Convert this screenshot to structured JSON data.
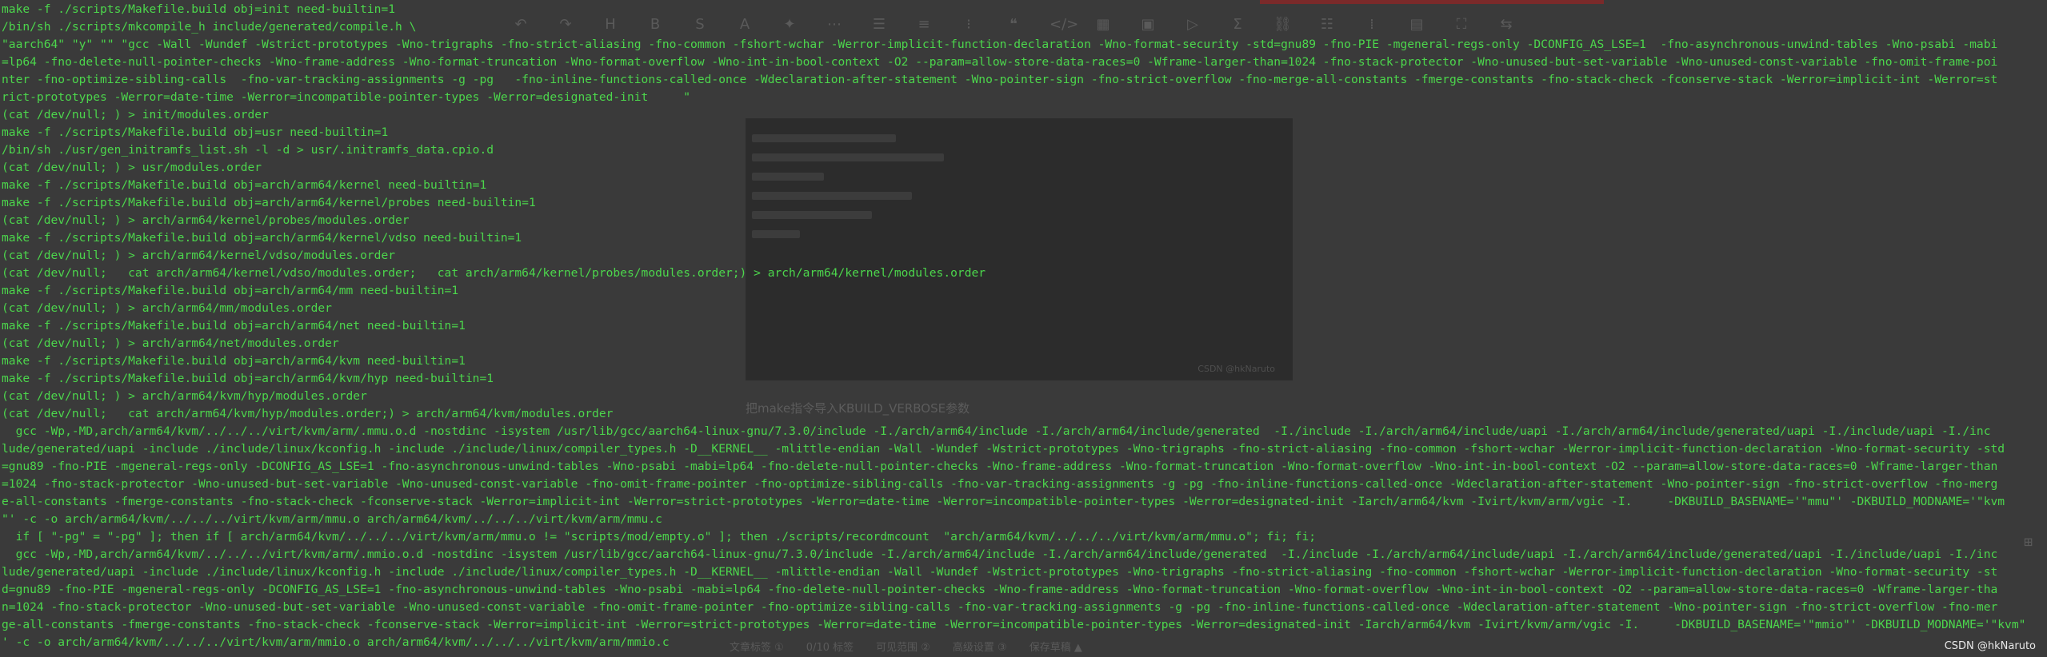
{
  "editor": {
    "toolbar_icons": [
      "undo-icon",
      "redo-icon",
      "heading-icon",
      "bold-icon",
      "strikethrough-icon",
      "color-icon",
      "format-clear-icon",
      "more-icon",
      "list-unordered-icon",
      "align-icon",
      "list-ordered-icon",
      "quote-icon",
      "code-icon",
      "table-icon",
      "image-icon",
      "video-icon",
      "formula-icon",
      "link-icon",
      "toc-icon",
      "outline-icon",
      "template-icon",
      "fullscreen-icon",
      "swap-icon"
    ],
    "caption": "把make指令导入KBUILD_VERBOSE参数",
    "code_watermark": "CSDN @hkNaruto",
    "bottom_items": [
      "文章标签 ①",
      "0/10 标签",
      "可见范围 ②",
      "高级设置 ③",
      "保存草稿 ▲"
    ]
  },
  "terminal": {
    "lines": [
      "make -f ./scripts/Makefile.build obj=init need-builtin=1",
      "/bin/sh ./scripts/mkcompile_h include/generated/compile.h \\",
      "\"aarch64\" \"y\" \"\" \"gcc -Wall -Wundef -Wstrict-prototypes -Wno-trigraphs -fno-strict-aliasing -fno-common -fshort-wchar -Werror-implicit-function-declaration -Wno-format-security -std=gnu89 -fno-PIE -mgeneral-regs-only -DCONFIG_AS_LSE=1  -fno-asynchronous-unwind-tables -Wno-psabi -mabi",
      "=lp64 -fno-delete-null-pointer-checks -Wno-frame-address -Wno-format-truncation -Wno-format-overflow -Wno-int-in-bool-context -O2 --param=allow-store-data-races=0 -Wframe-larger-than=1024 -fno-stack-protector -Wno-unused-but-set-variable -Wno-unused-const-variable -fno-omit-frame-poi",
      "nter -fno-optimize-sibling-calls  -fno-var-tracking-assignments -g -pg   -fno-inline-functions-called-once -Wdeclaration-after-statement -Wno-pointer-sign -fno-strict-overflow -fno-merge-all-constants -fmerge-constants -fno-stack-check -fconserve-stack -Werror=implicit-int -Werror=st",
      "rict-prototypes -Werror=date-time -Werror=incompatible-pointer-types -Werror=designated-init     \"",
      "(cat /dev/null; ) > init/modules.order",
      "make -f ./scripts/Makefile.build obj=usr need-builtin=1",
      "/bin/sh ./usr/gen_initramfs_list.sh -l -d > usr/.initramfs_data.cpio.d",
      "(cat /dev/null; ) > usr/modules.order",
      "make -f ./scripts/Makefile.build obj=arch/arm64/kernel need-builtin=1",
      "make -f ./scripts/Makefile.build obj=arch/arm64/kernel/probes need-builtin=1",
      "(cat /dev/null; ) > arch/arm64/kernel/probes/modules.order",
      "make -f ./scripts/Makefile.build obj=arch/arm64/kernel/vdso need-builtin=1",
      "(cat /dev/null; ) > arch/arm64/kernel/vdso/modules.order",
      "(cat /dev/null;   cat arch/arm64/kernel/vdso/modules.order;   cat arch/arm64/kernel/probes/modules.order;) > arch/arm64/kernel/modules.order",
      "make -f ./scripts/Makefile.build obj=arch/arm64/mm need-builtin=1",
      "(cat /dev/null; ) > arch/arm64/mm/modules.order",
      "make -f ./scripts/Makefile.build obj=arch/arm64/net need-builtin=1",
      "(cat /dev/null; ) > arch/arm64/net/modules.order",
      "make -f ./scripts/Makefile.build obj=arch/arm64/kvm need-builtin=1",
      "make -f ./scripts/Makefile.build obj=arch/arm64/kvm/hyp need-builtin=1",
      "(cat /dev/null; ) > arch/arm64/kvm/hyp/modules.order",
      "(cat /dev/null;   cat arch/arm64/kvm/hyp/modules.order;) > arch/arm64/kvm/modules.order",
      "  gcc -Wp,-MD,arch/arm64/kvm/../../../virt/kvm/arm/.mmu.o.d -nostdinc -isystem /usr/lib/gcc/aarch64-linux-gnu/7.3.0/include -I./arch/arm64/include -I./arch/arm64/include/generated  -I./include -I./arch/arm64/include/uapi -I./arch/arm64/include/generated/uapi -I./include/uapi -I./inc",
      "lude/generated/uapi -include ./include/linux/kconfig.h -include ./include/linux/compiler_types.h -D__KERNEL__ -mlittle-endian -Wall -Wundef -Wstrict-prototypes -Wno-trigraphs -fno-strict-aliasing -fno-common -fshort-wchar -Werror-implicit-function-declaration -Wno-format-security -std",
      "=gnu89 -fno-PIE -mgeneral-regs-only -DCONFIG_AS_LSE=1 -fno-asynchronous-unwind-tables -Wno-psabi -mabi=lp64 -fno-delete-null-pointer-checks -Wno-frame-address -Wno-format-truncation -Wno-format-overflow -Wno-int-in-bool-context -O2 --param=allow-store-data-races=0 -Wframe-larger-than",
      "=1024 -fno-stack-protector -Wno-unused-but-set-variable -Wno-unused-const-variable -fno-omit-frame-pointer -fno-optimize-sibling-calls -fno-var-tracking-assignments -g -pg -fno-inline-functions-called-once -Wdeclaration-after-statement -Wno-pointer-sign -fno-strict-overflow -fno-merg",
      "e-all-constants -fmerge-constants -fno-stack-check -fconserve-stack -Werror=implicit-int -Werror=strict-prototypes -Werror=date-time -Werror=incompatible-pointer-types -Werror=designated-init -Iarch/arm64/kvm -Ivirt/kvm/arm/vgic -I.     -DKBUILD_BASENAME='\"mmu\"' -DKBUILD_MODNAME='\"kvm",
      "\"' -c -o arch/arm64/kvm/../../../virt/kvm/arm/mmu.o arch/arm64/kvm/../../../virt/kvm/arm/mmu.c",
      "  if [ \"-pg\" = \"-pg\" ]; then if [ arch/arm64/kvm/../../../virt/kvm/arm/mmu.o != \"scripts/mod/empty.o\" ]; then ./scripts/recordmcount  \"arch/arm64/kvm/../../../virt/kvm/arm/mmu.o\"; fi; fi;",
      "  gcc -Wp,-MD,arch/arm64/kvm/../../../virt/kvm/arm/.mmio.o.d -nostdinc -isystem /usr/lib/gcc/aarch64-linux-gnu/7.3.0/include -I./arch/arm64/include -I./arch/arm64/include/generated  -I./include -I./arch/arm64/include/uapi -I./arch/arm64/include/generated/uapi -I./include/uapi -I./inc",
      "lude/generated/uapi -include ./include/linux/kconfig.h -include ./include/linux/compiler_types.h -D__KERNEL__ -mlittle-endian -Wall -Wundef -Wstrict-prototypes -Wno-trigraphs -fno-strict-aliasing -fno-common -fshort-wchar -Werror-implicit-function-declaration -Wno-format-security -st",
      "d=gnu89 -fno-PIE -mgeneral-regs-only -DCONFIG_AS_LSE=1 -fno-asynchronous-unwind-tables -Wno-psabi -mabi=lp64 -fno-delete-null-pointer-checks -Wno-frame-address -Wno-format-truncation -Wno-format-overflow -Wno-int-in-bool-context -O2 --param=allow-store-data-races=0 -Wframe-larger-tha",
      "n=1024 -fno-stack-protector -Wno-unused-but-set-variable -Wno-unused-const-variable -fno-omit-frame-pointer -fno-optimize-sibling-calls -fno-var-tracking-assignments -g -pg -fno-inline-functions-called-once -Wdeclaration-after-statement -Wno-pointer-sign -fno-strict-overflow -fno-mer",
      "ge-all-constants -fmerge-constants -fno-stack-check -fconserve-stack -Werror=implicit-int -Werror=strict-prototypes -Werror=date-time -Werror=incompatible-pointer-types -Werror=designated-init -Iarch/arm64/kvm -Ivirt/kvm/arm/vgic -I.     -DKBUILD_BASENAME='\"mmio\"' -DKBUILD_MODNAME='\"kvm\"",
      "' -c -o arch/arm64/kvm/../../../virt/kvm/arm/mmio.o arch/arm64/kvm/../../../virt/kvm/arm/mmio.c"
    ]
  },
  "badge": {
    "text": "CSDN @hkNaruto"
  }
}
